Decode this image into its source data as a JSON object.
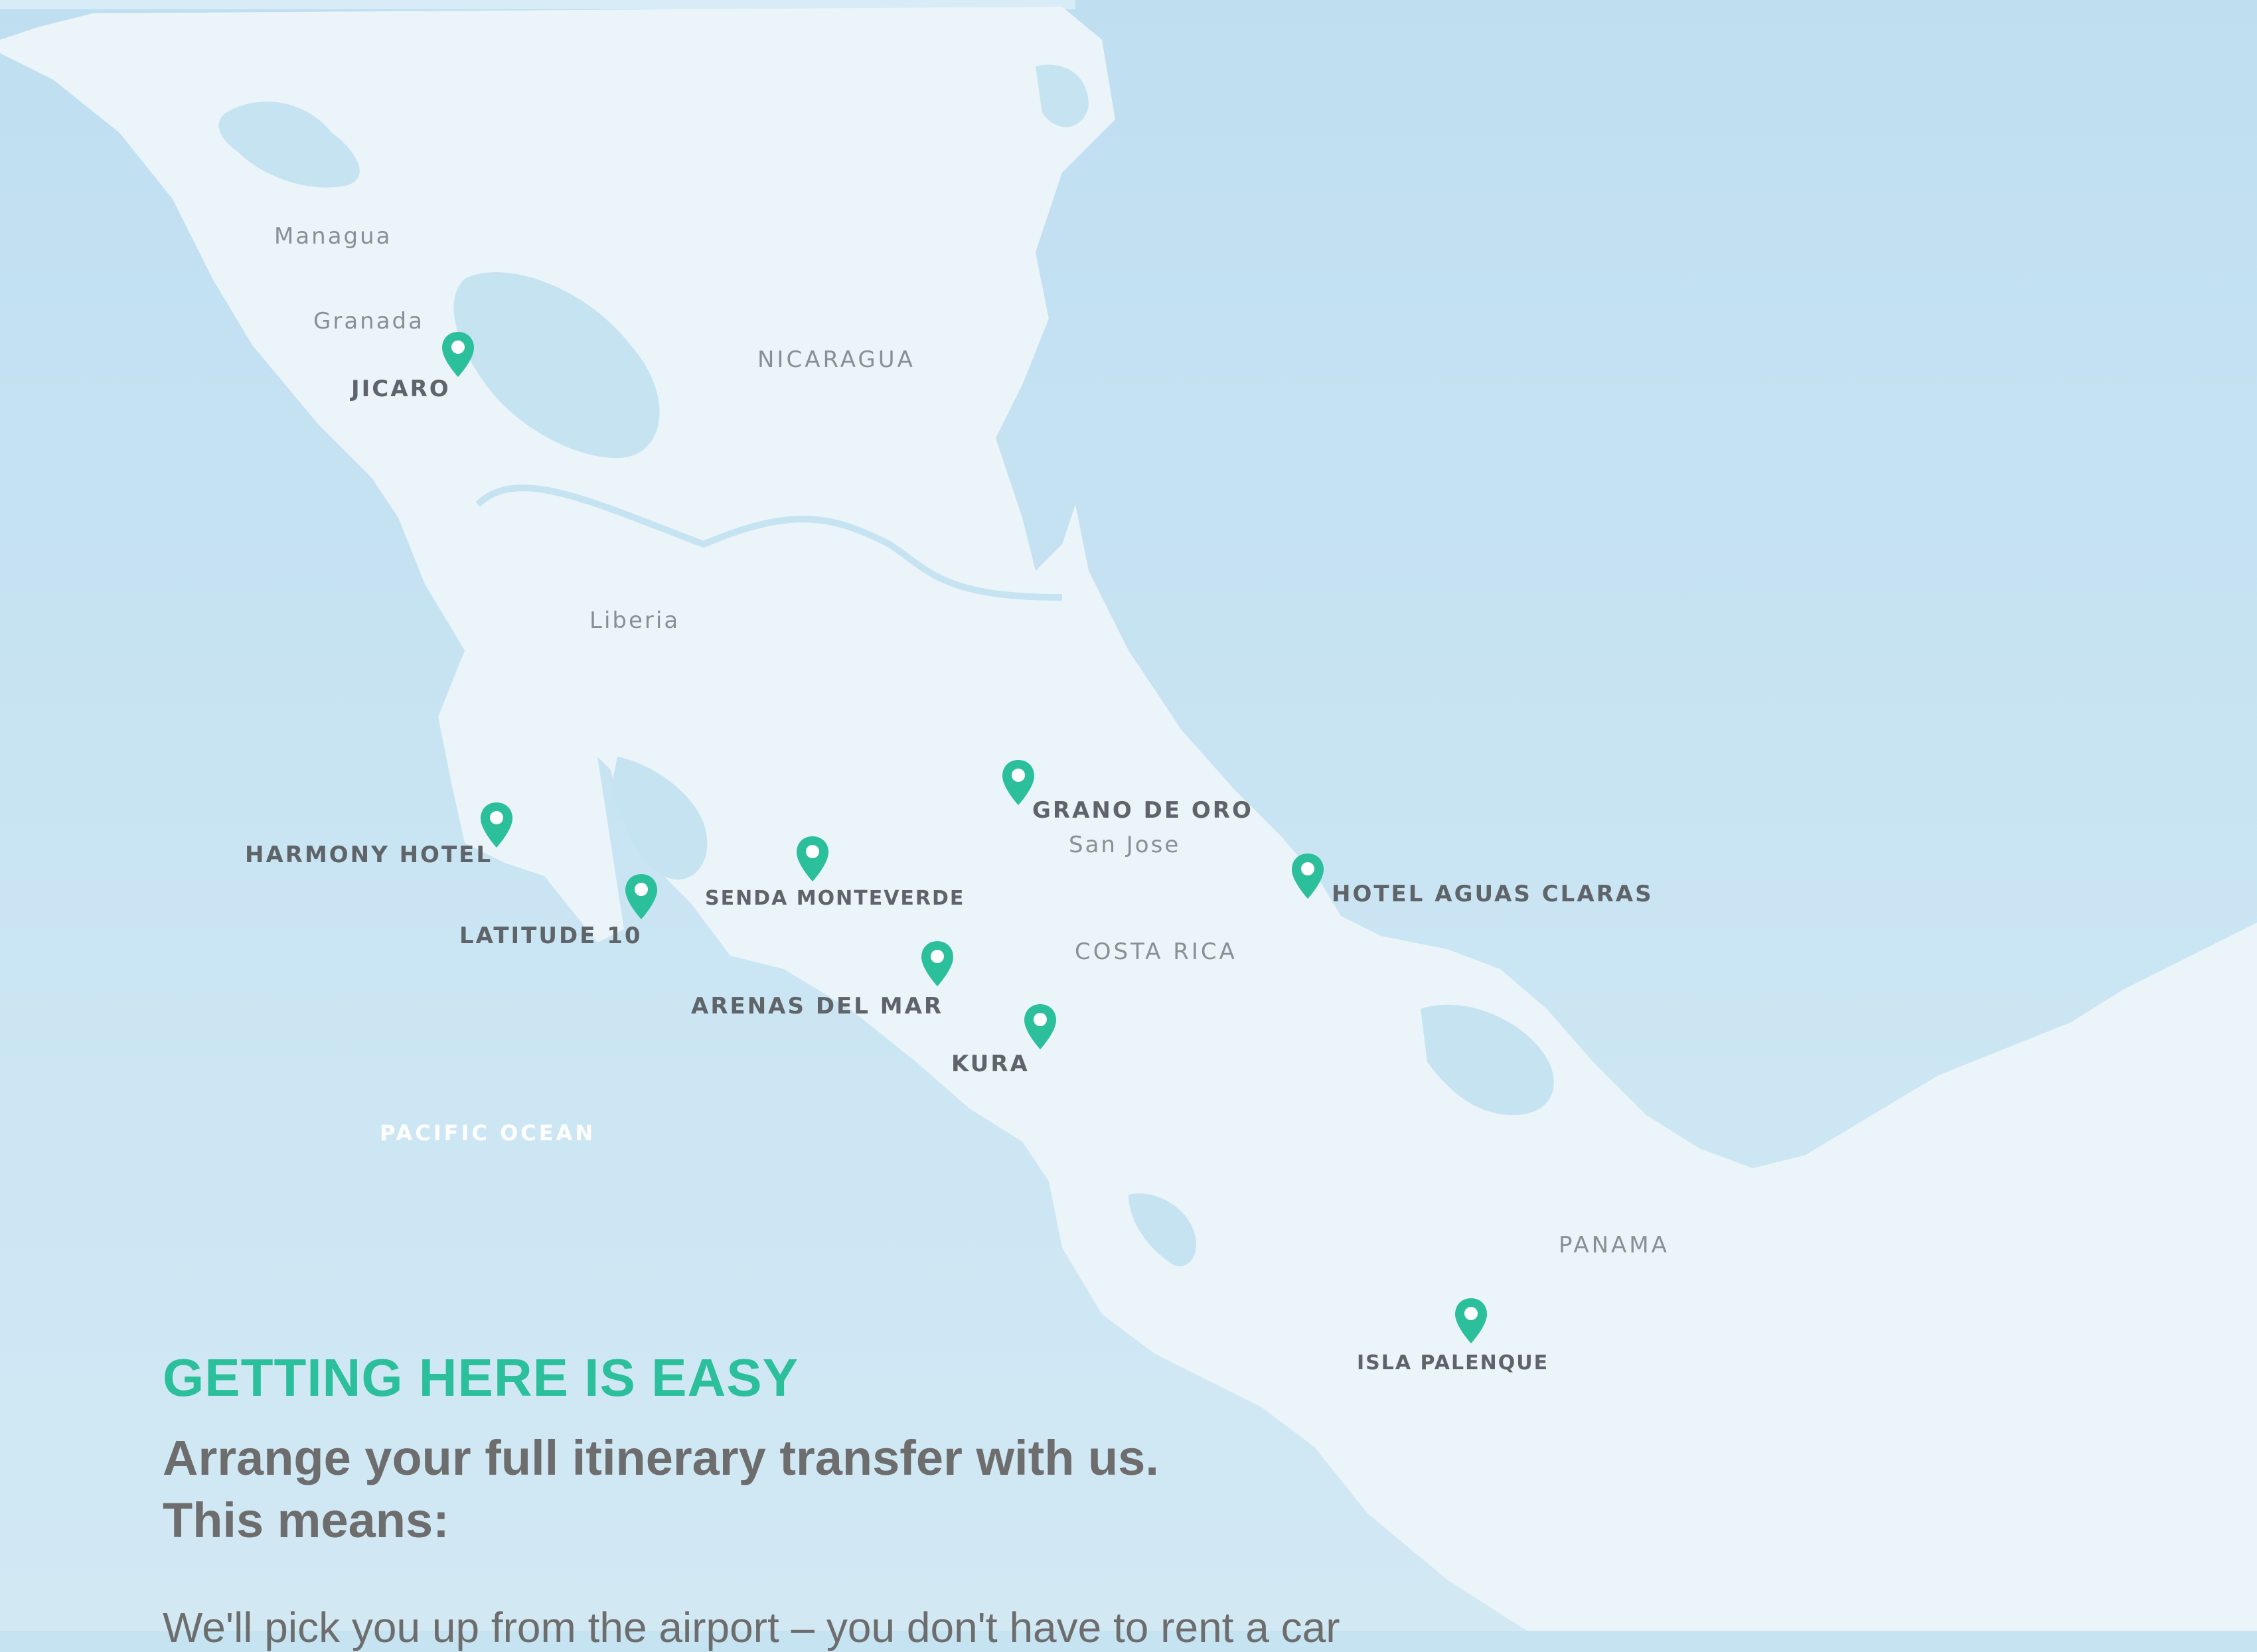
{
  "map": {
    "cities": [
      {
        "id": "managua",
        "label": "Managua"
      },
      {
        "id": "granada",
        "label": "Granada"
      },
      {
        "id": "liberia",
        "label": "Liberia"
      },
      {
        "id": "san-jose",
        "label": "San Jose"
      }
    ],
    "countries": [
      {
        "id": "nicaragua",
        "label": "NICARAGUA"
      },
      {
        "id": "costa-rica",
        "label": "COSTA RICA"
      },
      {
        "id": "panama",
        "label": "PANAMA"
      }
    ],
    "ocean": {
      "label": "PACIFIC OCEAN"
    },
    "hotels": [
      {
        "id": "jicaro",
        "label": "JICARO"
      },
      {
        "id": "harmony-hotel",
        "label": "HARMONY HOTEL"
      },
      {
        "id": "latitude-10",
        "label": "LATITUDE 10"
      },
      {
        "id": "senda-monteverde",
        "label": "SENDA MONTEVERDE"
      },
      {
        "id": "grano-de-oro",
        "label": "GRANO DE ORO"
      },
      {
        "id": "arenas-del-mar",
        "label": "ARENAS DEL MAR"
      },
      {
        "id": "kura",
        "label": "KURA"
      },
      {
        "id": "hotel-aguas-claras",
        "label": "HOTEL AGUAS CLARAS"
      },
      {
        "id": "isla-palenque",
        "label": "ISLA PALENQUE"
      }
    ],
    "colors": {
      "water": "#c6e3f2",
      "land": "#eaf4f9",
      "pin": "#2bbf9c"
    },
    "icon": "map-pin-icon"
  },
  "intro": {
    "heading": "GETTING HERE IS EASY",
    "subheading_line1": "Arrange your full itinerary transfer with us.",
    "subheading_line2": "This means:",
    "body": "We'll pick you up from the airport – you don't have to rent a car"
  }
}
